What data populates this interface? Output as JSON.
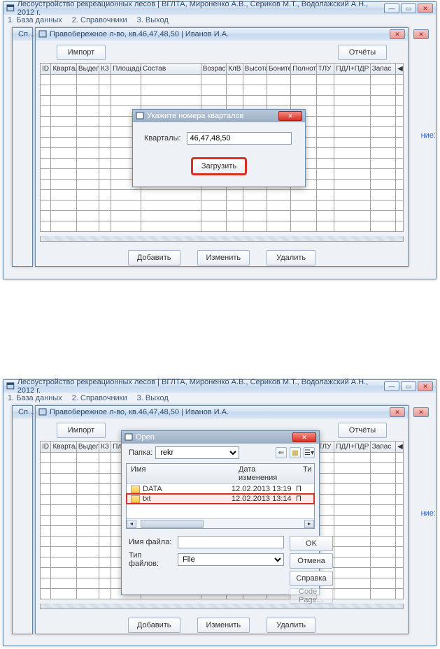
{
  "app_title": "Лесоустройство рекреационных лесов |   ВГЛТА, Мироненко А.В., Сериков М.Т., Водолажский А.Н., 2012 г.",
  "menu": {
    "m1": "1. База данных",
    "m2": "2. Справочники",
    "m3": "3. Выход"
  },
  "child_peek": "Сп...",
  "subwin_title": "Правобережное л-во, кв.46,47,48,50 | Иванов И.А.",
  "buttons": {
    "import": "Импорт",
    "reports": "Отчёты",
    "add": "Добавить",
    "edit": "Изменить",
    "delete": "Удалить",
    "load": "Загрузить",
    "ok": "OK",
    "cancel": "Отмена",
    "help": "Справка",
    "code_page": "Code Page..."
  },
  "columns": [
    "ID",
    "Квартал",
    "Выдел",
    "КЗ",
    "Площадь",
    "Состав",
    "Возраст",
    "КлВ",
    "Высота",
    "Боните",
    "Полнота",
    "ТЛУ",
    "ПДЛ+ПДР",
    "Запас"
  ],
  "sel_marker": "◀",
  "side_note": "ние:",
  "dlg1": {
    "title": "Укажите номера кварталов",
    "label": "Кварталы:",
    "value": "46,47,48,50"
  },
  "dlg2": {
    "title": "Open",
    "folder_label": "Папка:",
    "folder_value": "rekr",
    "col_name": "Имя",
    "col_date": "Дата изменения",
    "col_type": "Ти",
    "rows": [
      {
        "name": "DATA",
        "date": "12.02.2013 13:19",
        "type": "П"
      },
      {
        "name": "txt",
        "date": "12.02.2013 13:14",
        "type": "П"
      }
    ],
    "filename_label": "Имя файла:",
    "filename_value": "",
    "filetype_label": "Тип файлов:",
    "filetype_value": "File"
  }
}
